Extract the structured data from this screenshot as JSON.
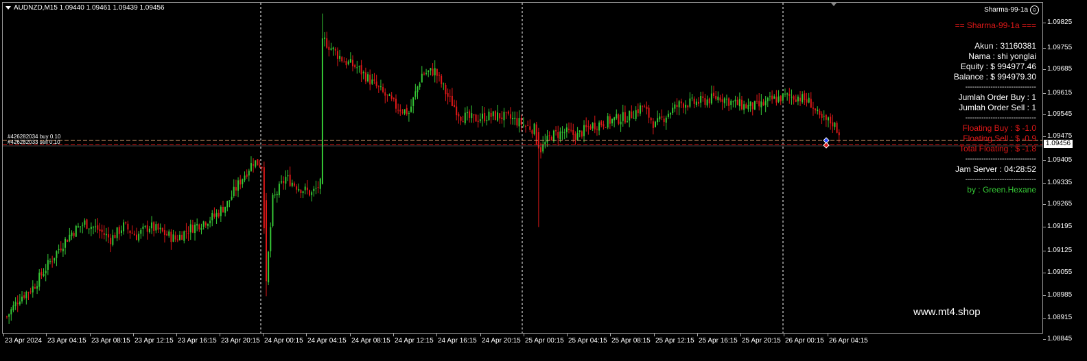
{
  "symbol_bar": {
    "text": "AUDNZD,M15  1.09440 1.09461 1.09439 1.09456"
  },
  "ea_label": {
    "name": "Sharma-99-1a",
    "icon": "smiley-icon"
  },
  "info_panel": {
    "title": "== Sharma-99-1a ===",
    "akun": "Akun : 31160381",
    "nama": "Nama : shi yonglai",
    "equity": "Equity : $ 994977.46",
    "balance": "Balance : $ 994979.30",
    "sep1": "-------------------------------",
    "order_buy": "Jumlah Order Buy : 1",
    "order_sell": "Jumlah Order Sell : 1",
    "sep2": "-------------------------------",
    "floating_buy": "Floating Buy : $ -1.0",
    "floating_sell": "Floating Sell : $ -0.9",
    "total_floating": "Total Floating : $ -1.8",
    "sep3": "-------------------------------",
    "jam_server": "Jam Server : 04:28:52",
    "sep4": "-------------------------------",
    "by": "by : Green.Hexane"
  },
  "watermark": "www.mt4.shop",
  "orders": {
    "buy_label": "#426282034 buy 0.10",
    "sell_label": "#426282033 sell 0.10"
  },
  "current_price": "1.09456",
  "price_axis": [
    "1.09825",
    "1.09755",
    "1.09685",
    "1.09615",
    "1.09545",
    "1.09475",
    "1.09405",
    "1.09335",
    "1.09265",
    "1.09195",
    "1.09125",
    "1.09055",
    "1.08985",
    "1.08915",
    "1.08845"
  ],
  "time_axis": [
    "23 Apr 2024",
    "23 Apr 04:15",
    "23 Apr 08:15",
    "23 Apr 12:15",
    "23 Apr 16:15",
    "23 Apr 20:15",
    "24 Apr 00:15",
    "24 Apr 04:15",
    "24 Apr 08:15",
    "24 Apr 12:15",
    "24 Apr 16:15",
    "24 Apr 20:15",
    "25 Apr 00:15",
    "25 Apr 04:15",
    "25 Apr 08:15",
    "25 Apr 12:15",
    "25 Apr 16:15",
    "25 Apr 20:15",
    "26 Apr 00:15",
    "26 Apr 04:15"
  ],
  "colors": {
    "bull": "#36c936",
    "bear": "#e01818",
    "buy_line": "#e0a070",
    "sell_line": "#e01818"
  },
  "chart_data": {
    "type": "candlestick",
    "ylim": [
      1.0884,
      1.0986
    ],
    "candles_anchor_path": [
      [
        0,
        1.0889
      ],
      [
        6,
        1.0895
      ],
      [
        12,
        1.0898
      ],
      [
        18,
        1.0904
      ],
      [
        24,
        1.091
      ],
      [
        30,
        1.0915
      ],
      [
        36,
        1.0918
      ],
      [
        42,
        1.0916
      ],
      [
        48,
        1.0913
      ],
      [
        54,
        1.0917
      ],
      [
        60,
        1.0914
      ],
      [
        66,
        1.0917
      ],
      [
        72,
        1.0915
      ],
      [
        78,
        1.0913
      ],
      [
        84,
        1.0916
      ],
      [
        90,
        1.0918
      ],
      [
        96,
        1.092
      ],
      [
        102,
        1.0924
      ],
      [
        108,
        1.0931
      ],
      [
        114,
        1.0937
      ],
      [
        118,
        1.0936
      ],
      [
        120,
        1.09
      ],
      [
        123,
        1.0925
      ],
      [
        129,
        1.0932
      ],
      [
        135,
        1.0929
      ],
      [
        141,
        1.0927
      ],
      [
        145,
        1.093
      ],
      [
        146,
        1.0975
      ],
      [
        150,
        1.0972
      ],
      [
        156,
        1.0968
      ],
      [
        162,
        1.0966
      ],
      [
        168,
        1.0962
      ],
      [
        174,
        1.0958
      ],
      [
        180,
        1.0954
      ],
      [
        186,
        1.0952
      ],
      [
        192,
        1.0964
      ],
      [
        198,
        1.0965
      ],
      [
        204,
        1.0957
      ],
      [
        210,
        1.0951
      ],
      [
        216,
        1.095
      ],
      [
        222,
        1.0951
      ],
      [
        228,
        1.0951
      ],
      [
        234,
        1.095
      ],
      [
        240,
        1.0948
      ],
      [
        244,
        1.0947
      ],
      [
        246,
        1.094
      ],
      [
        252,
        1.0945
      ],
      [
        258,
        1.0946
      ],
      [
        264,
        1.0945
      ],
      [
        270,
        1.0948
      ],
      [
        276,
        1.0949
      ],
      [
        282,
        1.095
      ],
      [
        288,
        1.0951
      ],
      [
        294,
        1.0954
      ],
      [
        300,
        1.0948
      ],
      [
        306,
        1.0952
      ],
      [
        312,
        1.0955
      ],
      [
        318,
        1.0955
      ],
      [
        324,
        1.0956
      ],
      [
        330,
        1.0957
      ],
      [
        336,
        1.0955
      ],
      [
        342,
        1.0954
      ],
      [
        348,
        1.0954
      ],
      [
        354,
        1.0956
      ],
      [
        360,
        1.0957
      ],
      [
        366,
        1.0957
      ],
      [
        372,
        1.0955
      ],
      [
        376,
        1.095
      ],
      [
        382,
        1.0949
      ],
      [
        386,
        1.0945
      ]
    ]
  }
}
